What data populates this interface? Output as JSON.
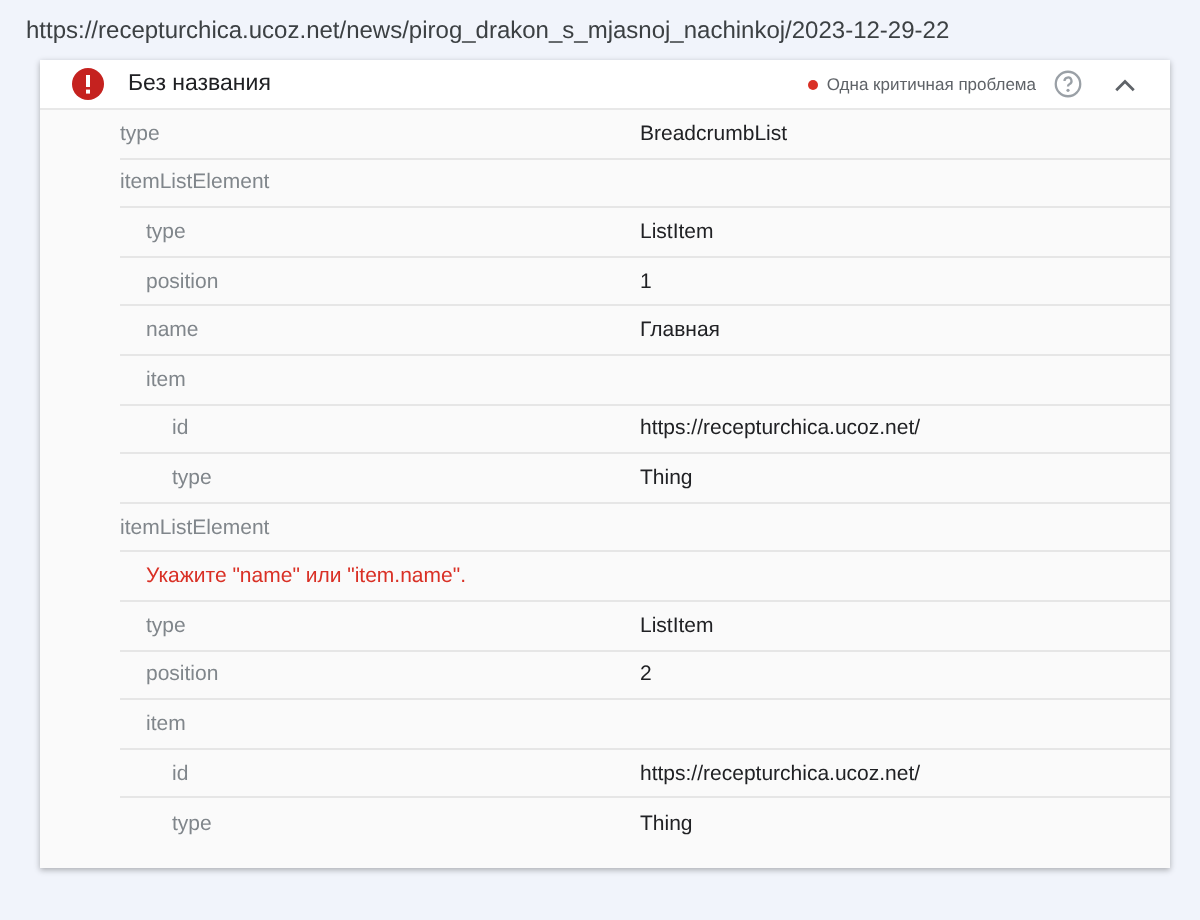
{
  "url": "https://recepturchica.ucoz.net/news/pirog_drakon_s_mjasnoj_nachinkoj/2023-12-29-22",
  "card": {
    "title": "Без названия",
    "issue": "Одна критичная проблема",
    "critical": true,
    "expanded": true,
    "fields": [
      {
        "kind": "field",
        "label": "type",
        "value": "BreadcrumbList"
      },
      {
        "kind": "field",
        "label": "itemListElement",
        "children": [
          {
            "kind": "field",
            "label": "type",
            "value": "ListItem"
          },
          {
            "kind": "field",
            "label": "position",
            "value": "1"
          },
          {
            "kind": "field",
            "label": "name",
            "value": "Главная"
          },
          {
            "kind": "field",
            "label": "item",
            "children": [
              {
                "kind": "field",
                "label": "id",
                "value": "https://recepturchica.ucoz.net/"
              },
              {
                "kind": "field",
                "label": "type",
                "value": "Thing"
              }
            ]
          }
        ]
      },
      {
        "kind": "field",
        "label": "itemListElement",
        "children": [
          {
            "kind": "error",
            "text": "Укажите \"name\" или \"item.name\"."
          },
          {
            "kind": "field",
            "label": "type",
            "value": "ListItem"
          },
          {
            "kind": "field",
            "label": "position",
            "value": "2"
          },
          {
            "kind": "field",
            "label": "item",
            "children": [
              {
                "kind": "field",
                "label": "id",
                "value": "https://recepturchica.ucoz.net/"
              },
              {
                "kind": "field",
                "label": "type",
                "value": "Thing"
              }
            ]
          }
        ]
      }
    ]
  }
}
